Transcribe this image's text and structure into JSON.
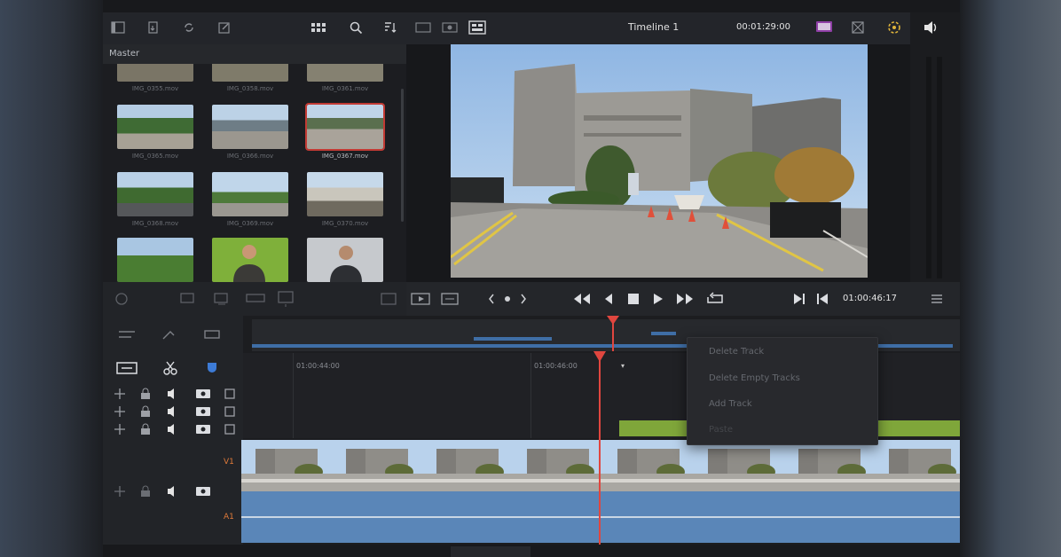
{
  "header": {
    "timeline_name": "Timeline 1",
    "duration_tc": "00:01:29:00"
  },
  "media_pool": {
    "bin_label": "Master",
    "clips": [
      {
        "name": "IMG_0355.mov",
        "selected": false
      },
      {
        "name": "IMG_0358.mov",
        "selected": false
      },
      {
        "name": "IMG_0361.mov",
        "selected": false
      },
      {
        "name": "IMG_0365.mov",
        "selected": false
      },
      {
        "name": "IMG_0366.mov",
        "selected": false
      },
      {
        "name": "IMG_0367.mov",
        "selected": true
      },
      {
        "name": "IMG_0368.mov",
        "selected": false
      },
      {
        "name": "IMG_0369.mov",
        "selected": false
      },
      {
        "name": "IMG_0370.mov",
        "selected": false
      },
      {
        "name": "",
        "selected": false
      },
      {
        "name": "",
        "selected": false
      },
      {
        "name": "",
        "selected": false
      }
    ]
  },
  "transport": {
    "current_tc": "01:00:46:17"
  },
  "timeline": {
    "ruler_marks": [
      "01:00:44:00",
      "01:00:46:00"
    ],
    "track_labels": {
      "video": "V1",
      "audio": "A1"
    }
  },
  "context_menu": {
    "items": [
      "Delete Track",
      "Delete Empty Tracks",
      "Add Track",
      "Paste"
    ]
  },
  "colors": {
    "playhead": "#e0463f",
    "accent_blue": "#3f6ea6",
    "selection_red": "#c23a34",
    "audio_track": "#5a86b8"
  },
  "icons": [
    "sidebar-toggle-icon",
    "import-icon",
    "sync-icon",
    "edit-icon",
    "grid-view-icon",
    "search-icon",
    "sort-icon",
    "volume-icon",
    "prev-clip-icon",
    "step-back-icon",
    "stop-icon",
    "play-icon",
    "next-clip-icon",
    "loop-icon",
    "razor-icon"
  ]
}
